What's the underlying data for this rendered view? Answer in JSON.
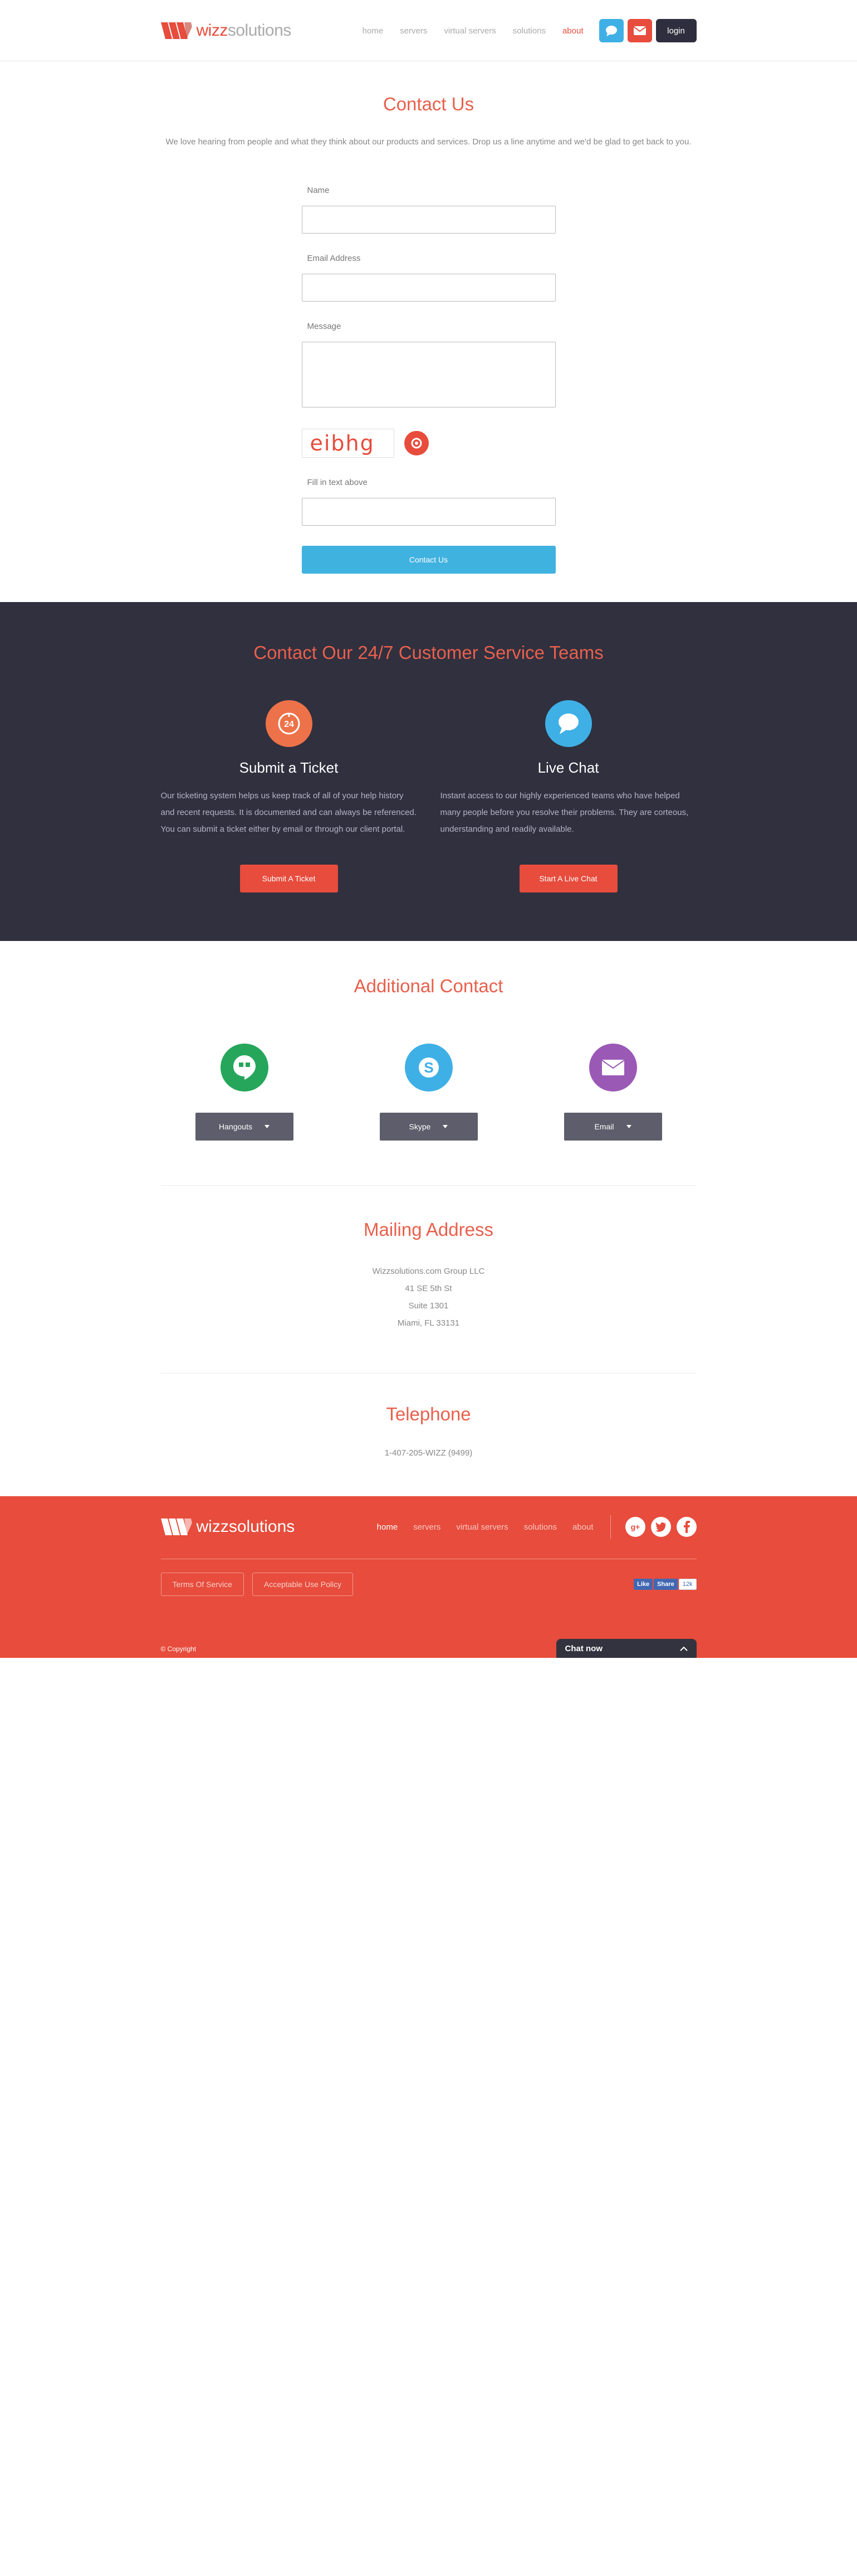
{
  "header": {
    "logo": {
      "brand_bold": "wizz",
      "brand_rest": "solutions"
    },
    "nav": [
      "home",
      "servers",
      "virtual servers",
      "solutions",
      "about"
    ],
    "active_nav": "about",
    "chat_icon": "speech-bubble-icon",
    "mail_icon": "envelope-icon",
    "login_label": "login"
  },
  "contact": {
    "title": "Contact Us",
    "intro": "We love hearing from people and what they think about our products and services. Drop us a line anytime and we'd be glad to get back to you.",
    "name_label": "Name",
    "email_label": "Email Address",
    "message_label": "Message",
    "captcha_text": "eibhg",
    "captcha_label": "Fill in text above",
    "submit_label": "Contact Us"
  },
  "service": {
    "title": "Contact Our 24/7 Customer Service Teams",
    "ticket": {
      "title": "Submit a Ticket",
      "text": "Our ticketing system helps us keep track of all of your help history and recent requests. It is documented and can always be referenced. You can submit a ticket either by email or through our client portal.",
      "button": "Submit A Ticket",
      "icon": "clock-24-icon"
    },
    "livechat": {
      "title": "Live Chat",
      "text": "Instant access to our highly experienced teams who have helped many people before you resolve their problems. They are corteous, understanding and readily available.",
      "button": "Start A Live Chat",
      "icon": "chat-bubble-icon"
    }
  },
  "additional": {
    "title": "Additional Contact",
    "items": [
      {
        "label": "Hangouts",
        "icon": "hangouts-icon",
        "color": "#26a65b"
      },
      {
        "label": "Skype",
        "icon": "skype-icon",
        "color": "#3fb0e6"
      },
      {
        "label": "Email",
        "icon": "envelope-icon",
        "color": "#9b59b6"
      }
    ]
  },
  "mailing": {
    "title": "Mailing Address",
    "lines": [
      "Wizzsolutions.com Group LLC",
      "41 SE 5th St",
      "Suite 1301",
      "Miami, FL 33131"
    ]
  },
  "telephone": {
    "title": "Telephone",
    "number": "1-407-205-WIZZ (9499)"
  },
  "footer": {
    "logo": {
      "brand_bold": "wizz",
      "brand_rest": "solutions"
    },
    "nav": [
      "home",
      "servers",
      "virtual servers",
      "solutions",
      "about"
    ],
    "active_nav": "home",
    "socials": [
      "google-plus-icon",
      "twitter-icon",
      "facebook-icon"
    ],
    "terms": "Terms Of Service",
    "policy": "Acceptable Use Policy",
    "fb_like": "Like",
    "fb_share": "Share",
    "fb_count": "12k",
    "copyright": "© Copyright",
    "chat_label": "Chat now"
  },
  "colors": {
    "accent": "#e74c3c",
    "title": "#e8604c",
    "blue": "#40b2e0",
    "dark": "#30303f"
  }
}
